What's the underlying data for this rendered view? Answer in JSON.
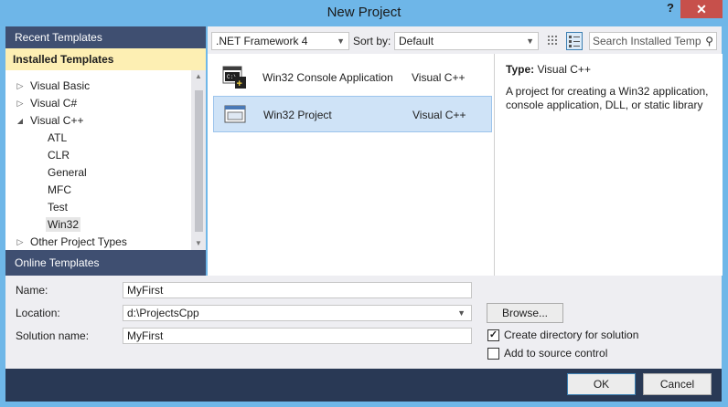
{
  "window": {
    "title": "New Project",
    "help_glyph": "?",
    "close_glyph": "✕"
  },
  "left_panel": {
    "recent_label": "Recent Templates",
    "installed_label": "Installed Templates",
    "online_label": "Online Templates",
    "tree": [
      {
        "label": "Visual Basic",
        "expander": "▷"
      },
      {
        "label": "Visual C#",
        "expander": "▷"
      },
      {
        "label": "Visual C++",
        "expander": "◢"
      },
      {
        "label": "ATL"
      },
      {
        "label": "CLR"
      },
      {
        "label": "General"
      },
      {
        "label": "MFC"
      },
      {
        "label": "Test"
      },
      {
        "label": "Win32"
      },
      {
        "label": "Other Project Types",
        "expander": "▷"
      }
    ]
  },
  "toolbar": {
    "framework": ".NET Framework 4",
    "sort_label": "Sort by:",
    "sort_value": "Default",
    "search_placeholder": "Search Installed Temp"
  },
  "templates": [
    {
      "name": "Win32 Console Application",
      "language": "Visual C++"
    },
    {
      "name": "Win32 Project",
      "language": "Visual C++"
    }
  ],
  "info": {
    "type_label": "Type:",
    "type_value": "Visual C++",
    "description": "A project for creating a Win32 application, console application, DLL, or static library"
  },
  "form": {
    "name_label": "Name:",
    "name_value": "MyFirst",
    "location_label": "Location:",
    "location_value": "d:\\ProjectsCpp",
    "solution_label": "Solution name:",
    "solution_value": "MyFirst",
    "browse_label": "Browse...",
    "create_dir_label": "Create directory for solution",
    "create_dir_checked": true,
    "source_control_label": "Add to source control",
    "source_control_checked": false
  },
  "buttons": {
    "ok": "OK",
    "cancel": "Cancel"
  }
}
